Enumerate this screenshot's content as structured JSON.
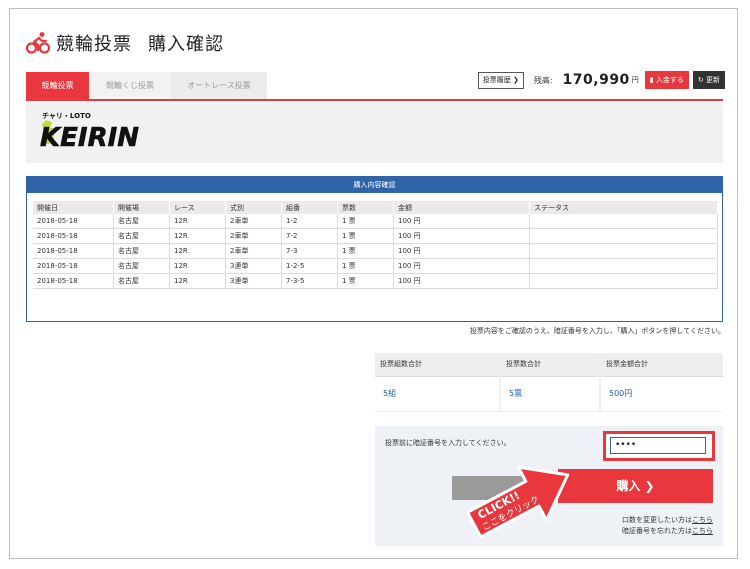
{
  "header": {
    "title": "競輪投票",
    "subtitle": "購入確認"
  },
  "tabs": [
    {
      "label": "競輪投票",
      "active": true
    },
    {
      "label": "競輪くじ投票",
      "active": false
    },
    {
      "label": "オートレース投票",
      "active": false
    }
  ],
  "account": {
    "history_label": "投票履歴 ❯",
    "balance_label": "残高:",
    "balance": "170,990",
    "currency": "円",
    "deposit_label": "入金する",
    "update_label": "更新"
  },
  "logo": {
    "top": "チャリ・LOTO",
    "main": "KEIRIN"
  },
  "panel": {
    "title": "購入内容確認",
    "columns": [
      "開催日",
      "開催場",
      "レース",
      "式別",
      "組番",
      "票数",
      "金額",
      "ステータス"
    ],
    "rows": [
      [
        "2018-05-18",
        "名古屋",
        "12R",
        "2車単",
        "1-2",
        "1 票",
        "100 円",
        ""
      ],
      [
        "2018-05-18",
        "名古屋",
        "12R",
        "2車単",
        "7-2",
        "1 票",
        "100 円",
        ""
      ],
      [
        "2018-05-18",
        "名古屋",
        "12R",
        "2車単",
        "7-3",
        "1 票",
        "100 円",
        ""
      ],
      [
        "2018-05-18",
        "名古屋",
        "12R",
        "3連単",
        "1-2-5",
        "1 票",
        "100 円",
        ""
      ],
      [
        "2018-05-18",
        "名古屋",
        "12R",
        "3連単",
        "7-3-5",
        "1 票",
        "100 円",
        ""
      ]
    ]
  },
  "note": "投票内容をご確認のうえ、暗証番号を入力し、「購入」ボタンを押してください。",
  "summary": [
    {
      "label": "投票組数合計",
      "value": "5組"
    },
    {
      "label": "投票数合計",
      "value": "5票"
    },
    {
      "label": "投票金額合計",
      "value": "500円"
    }
  ],
  "auth": {
    "label": "投票前に暗証番号を入力してください。",
    "value": "••••",
    "buy_label": "購入 ❯",
    "link1_prefix": "口数を変更したい方は",
    "link1": "こちら",
    "link2_prefix": "暗証番号を忘れた方は",
    "link2": "こちら"
  },
  "callout": {
    "line1": "CLICK!!",
    "line2": "ここをクリック"
  },
  "colors": {
    "accent": "#e8383d",
    "blue": "#2f64a8"
  }
}
